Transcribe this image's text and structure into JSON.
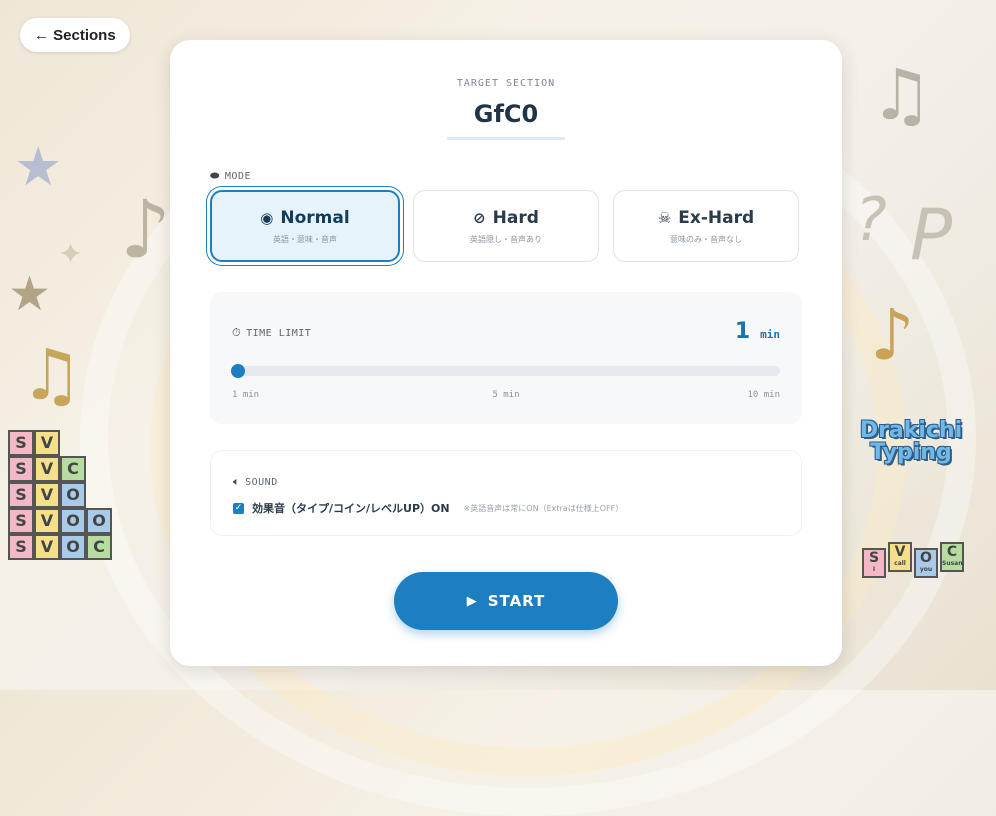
{
  "nav": {
    "back_label": "← Sections"
  },
  "target": {
    "label": "TARGET SECTION",
    "name": "GfC0"
  },
  "mode": {
    "label": "MODE",
    "options": [
      {
        "title": "Normal",
        "subtitle": "英語・意味・音声",
        "icon": "eye-icon",
        "active": true
      },
      {
        "title": "Hard",
        "subtitle": "英語隠し・音声あり",
        "icon": "eye-slash-icon",
        "active": false
      },
      {
        "title": "Ex-Hard",
        "subtitle": "意味のみ・音声なし",
        "icon": "skull-icon",
        "active": false
      }
    ]
  },
  "time_limit": {
    "label": "TIME LIMIT",
    "value": "1",
    "unit": "min",
    "slider_value": 1,
    "slider_min": 1,
    "slider_max": 10,
    "tick_min": "1 min",
    "tick_mid": "5 min",
    "tick_max": "10 min"
  },
  "sound": {
    "label": "SOUND",
    "checkbox_label": "効果音（タイプ/コイン/レベルUP）ON",
    "checked": true,
    "note": "※英語音声は常にON（Extraは仕様上OFF）"
  },
  "start": {
    "label": "START"
  },
  "branding": {
    "logo_line1": "Drakichi",
    "logo_line2": "Typing",
    "blocks_left": [
      [
        "S",
        "V"
      ],
      [
        "S",
        "V",
        "C"
      ],
      [
        "S",
        "V",
        "O"
      ],
      [
        "S",
        "V",
        "O",
        "O"
      ],
      [
        "S",
        "V",
        "O",
        "C"
      ]
    ],
    "blocks_right": [
      "S",
      "V",
      "O",
      "C"
    ],
    "block_captions": [
      "I",
      "call",
      "you",
      "Susan"
    ]
  },
  "colors": {
    "accent": "#1d7fbf",
    "active_bg": "#e7f3fa",
    "heading": "#1f3447"
  }
}
